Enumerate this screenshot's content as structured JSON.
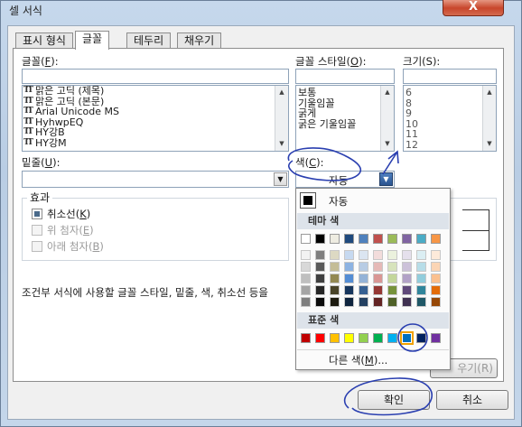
{
  "window": {
    "title": "셀 서식",
    "close_label": "X"
  },
  "tabs": [
    {
      "label": "표시 형식"
    },
    {
      "label": "글꼴"
    },
    {
      "label": "테두리"
    },
    {
      "label": "채우기"
    }
  ],
  "font": {
    "label_prefix": "글꼴(",
    "label_key": "F",
    "label_suffix": "):",
    "items": [
      "맑은 고딕 (제목)",
      "맑은 고딕 (본문)",
      "Arial Unicode MS",
      "HyhwpEQ",
      "HY강B",
      "HY강M"
    ]
  },
  "style": {
    "label_prefix": "글꼴 스타일(",
    "label_key": "O",
    "label_suffix": "):",
    "items": [
      "보통",
      "기울임꼴",
      "굵게",
      "굵은 기울임꼴"
    ]
  },
  "size": {
    "label": "크기(S):",
    "items": [
      "6",
      "8",
      "9",
      "10",
      "11",
      "12"
    ]
  },
  "underline": {
    "label_prefix": "밑줄(",
    "label_key": "U",
    "label_suffix": "):"
  },
  "color": {
    "label_prefix": "색(",
    "label_key": "C",
    "label_suffix": "):",
    "value": "자동"
  },
  "effects": {
    "title": "효과",
    "strike_prefix": "취소선(",
    "strike_key": "K",
    "strike_suffix": ")",
    "super_prefix": "위 첨자(",
    "super_key": "E",
    "super_suffix": ")",
    "sub_prefix": "아래 첨자(",
    "sub_key": "B",
    "sub_suffix": ")"
  },
  "note": "조건부 서식에 사용할 글꼴 스타일, 밑줄, 색, 취소선 등을",
  "palette": {
    "auto_label": "자동",
    "theme_title": "테마 색",
    "standard_title": "표준 색",
    "more_prefix": "다른 색(",
    "more_key": "M",
    "more_suffix": ")...",
    "theme_top": [
      "#ffffff",
      "#000000",
      "#eeece1",
      "#1f497d",
      "#4f81bd",
      "#c0504d",
      "#9bbb59",
      "#8064a2",
      "#4bacc6",
      "#f79646"
    ],
    "theme_shades": [
      [
        "#f2f2f2",
        "#7f7f7f",
        "#ddd9c3",
        "#c6d9f0",
        "#dbe5f1",
        "#f2dcdb",
        "#ebf1dd",
        "#e5e0ec",
        "#dbeef3",
        "#fdeada"
      ],
      [
        "#d8d8d8",
        "#595959",
        "#c4bd97",
        "#8db3e2",
        "#b8cce4",
        "#e5b9b7",
        "#d7e3bc",
        "#ccc1d9",
        "#b7dde8",
        "#fbd5b5"
      ],
      [
        "#bfbfbf",
        "#3f3f3f",
        "#938953",
        "#548dd4",
        "#95b3d7",
        "#d99694",
        "#c3d69b",
        "#b2a2c7",
        "#92cddc",
        "#fac08f"
      ],
      [
        "#a5a5a5",
        "#262626",
        "#494429",
        "#17365d",
        "#366092",
        "#953734",
        "#76923c",
        "#5f497a",
        "#31859b",
        "#e36c09"
      ],
      [
        "#7f7f7f",
        "#0c0c0c",
        "#1d1b10",
        "#0f243e",
        "#244061",
        "#632423",
        "#4f6128",
        "#3f3151",
        "#205867",
        "#974806"
      ]
    ],
    "standard": [
      "#c00000",
      "#ff0000",
      "#ffc000",
      "#ffff00",
      "#92d050",
      "#00b050",
      "#00b0f0",
      "#0070c0",
      "#002060",
      "#7030a0"
    ],
    "selected_standard_index": 7
  },
  "buttons": {
    "ok": "확인",
    "cancel": "취소",
    "clear_partial": "우기(R)"
  }
}
